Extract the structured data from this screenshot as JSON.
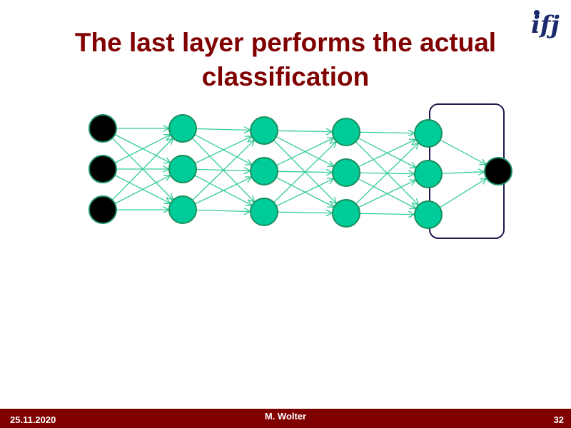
{
  "slide": {
    "title": "The last layer performs the actual classification",
    "logo_text": "ifj"
  },
  "diagram": {
    "layers": [
      {
        "role": "input",
        "nodes": 3,
        "color": "#000000"
      },
      {
        "role": "hidden",
        "nodes": 3,
        "color": "#00cc99"
      },
      {
        "role": "hidden",
        "nodes": 3,
        "color": "#00cc99"
      },
      {
        "role": "hidden",
        "nodes": 3,
        "color": "#00cc99"
      },
      {
        "role": "hidden",
        "nodes": 3,
        "color": "#00cc99"
      },
      {
        "role": "output",
        "nodes": 1,
        "color": "#000000"
      }
    ],
    "edge_color": "#33cc99",
    "node_stroke": "#1a8f5e",
    "highlight_box_color": "#1a1a4e"
  },
  "footer": {
    "date": "25.11.2020",
    "author": "M. Wolter",
    "page": "32",
    "background": "#800000"
  }
}
